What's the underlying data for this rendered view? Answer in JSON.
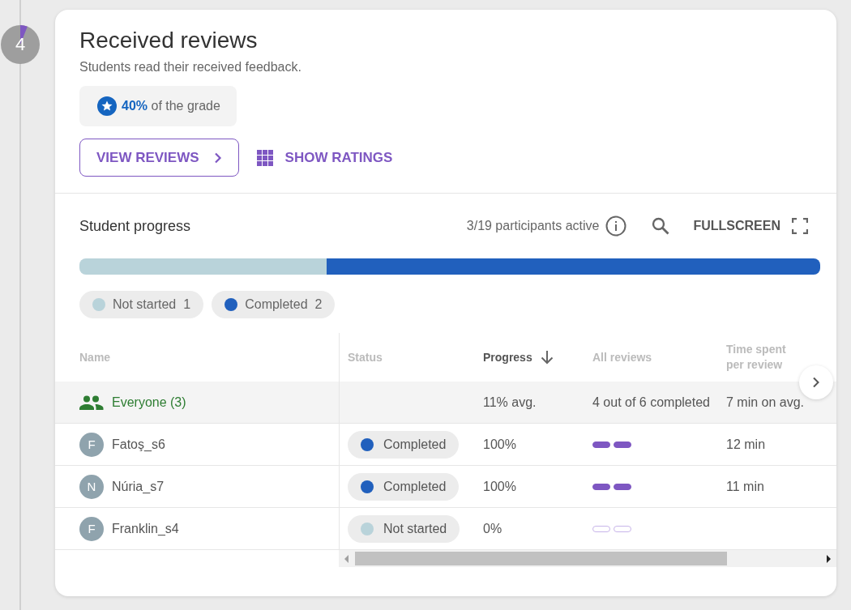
{
  "step": {
    "number": "4",
    "level": 0.06
  },
  "card": {
    "title": "Received reviews",
    "subtitle": "Students read their received feedback.",
    "grade": "**40%** of the grade",
    "buttons": [
      {
        "label": "VIEW REVIEWS",
        "kind": "outlined"
      },
      {
        "label": "SHOW RATINGS",
        "kind": "text"
      }
    ]
  },
  "progress": {
    "title": "Student progress",
    "participants": "3/19 participants active",
    "fullscreen": "FULLSCREEN",
    "legend": [
      {
        "label": "Not started",
        "count": "1",
        "color": "#b9d3da"
      },
      {
        "label": "Completed",
        "count": "2",
        "color": "#2160bd"
      }
    ]
  },
  "table": {
    "columns": [
      {
        "label": "Name",
        "sorted": false
      },
      {
        "label": "Status",
        "sorted": false
      },
      {
        "label": "Progress",
        "sorted": true
      },
      {
        "label": "All reviews",
        "sorted": false
      },
      {
        "label": "Time spent per review",
        "sorted": false
      }
    ],
    "summary": {
      "name": "Everyone (3)",
      "progress": "11% avg.",
      "reviews": "4 out of 6 completed",
      "time": "7 min on avg."
    },
    "rows": [
      {
        "initial": "F",
        "name": "Fatoş_s6",
        "status": "Completed",
        "color": "#2160bd",
        "progress": "100%",
        "reviews": [
          {
            "completed": true
          },
          {
            "completed": true
          }
        ],
        "time": "12 min"
      },
      {
        "initial": "N",
        "name": "Núria_s7",
        "status": "Completed",
        "color": "#2160bd",
        "progress": "100%",
        "reviews": [
          {
            "completed": true
          },
          {
            "completed": true
          }
        ],
        "time": "11 min"
      },
      {
        "initial": "F",
        "name": "Franklin_s4",
        "status": "Not started",
        "color": "#b9d3da",
        "progress": "0%",
        "reviews": [
          {
            "completed": false
          },
          {
            "completed": false
          }
        ],
        "time": ""
      }
    ]
  }
}
